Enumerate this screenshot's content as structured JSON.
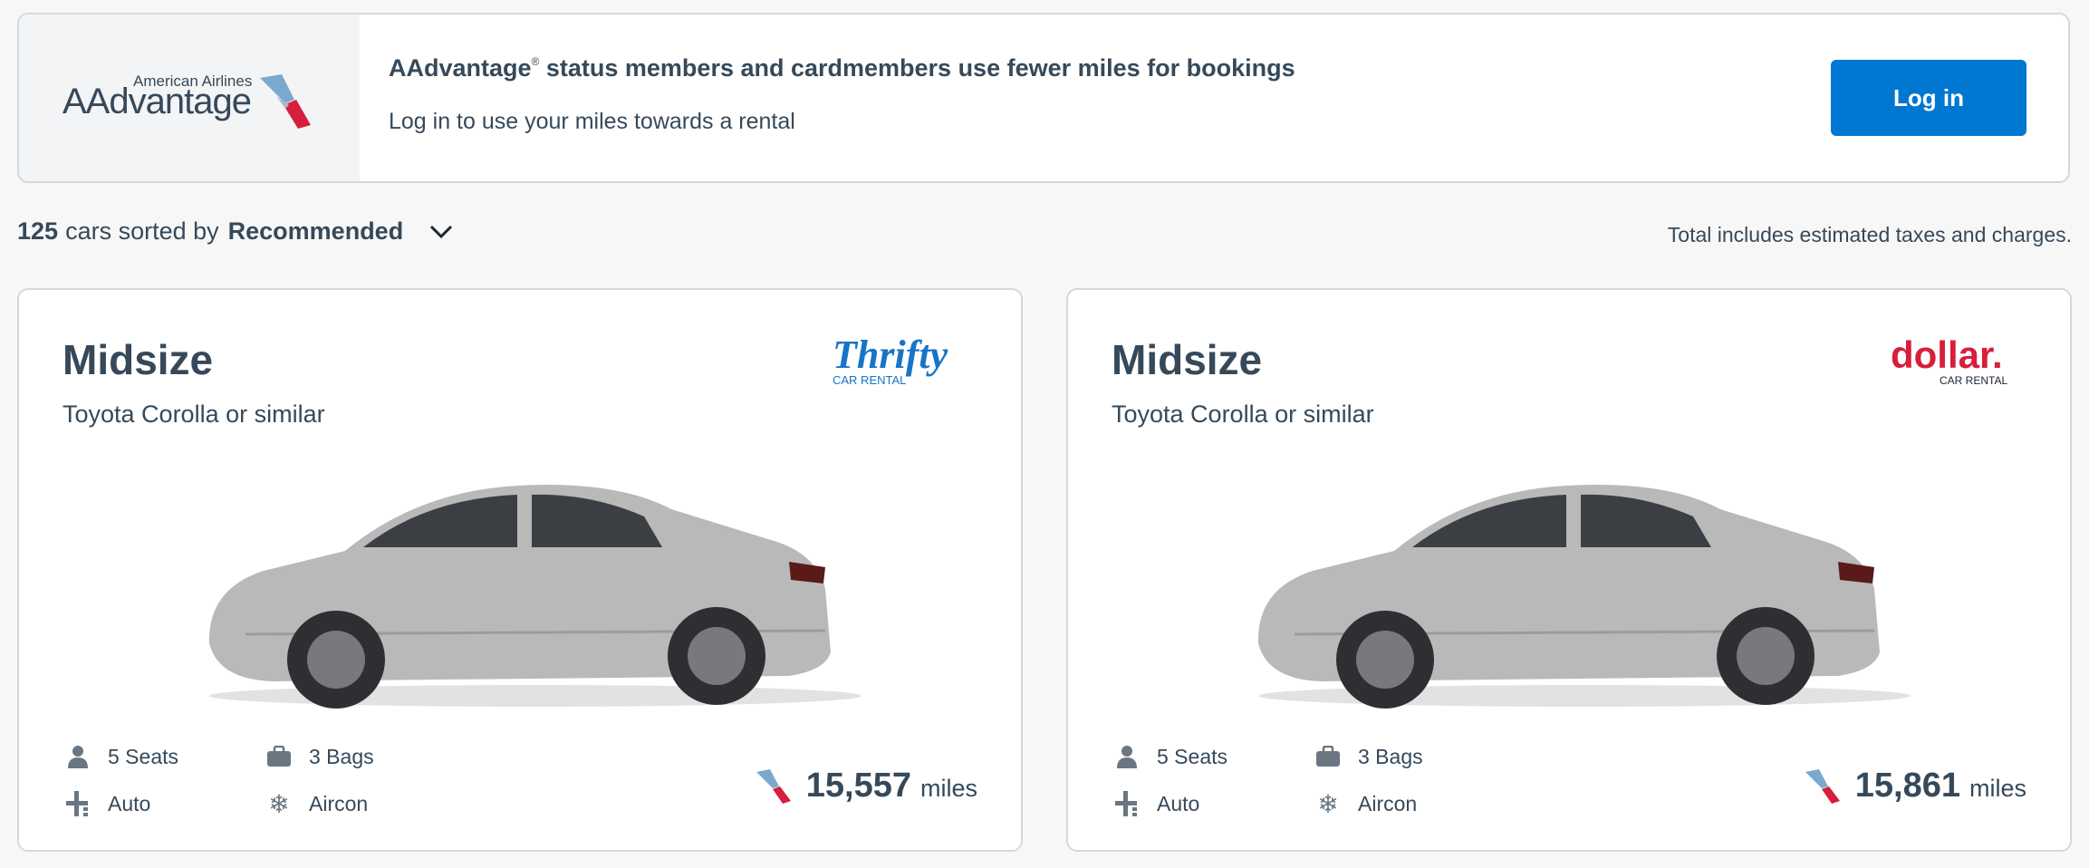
{
  "banner": {
    "logo_small": "American Airlines",
    "logo_big": "AAdvantage",
    "title_brand": "AAdvantage",
    "title_reg": "®",
    "title_rest": " status members and cardmembers use fewer miles for bookings",
    "subtitle": "Log in to use your miles towards a rental",
    "login_label": "Log in"
  },
  "results": {
    "count": "125",
    "sorted_text": "cars sorted by",
    "sort_value": "Recommended",
    "tax_note": "Total includes estimated taxes and charges."
  },
  "cards": [
    {
      "class": "Midsize",
      "model": "Toyota Corolla or similar",
      "vendor": "Thrifty",
      "vendor_sub": "CAR RENTAL",
      "seats": "5 Seats",
      "bags": "3 Bags",
      "transmission": "Auto",
      "aircon": "Aircon",
      "miles": "15,557",
      "miles_unit": "miles"
    },
    {
      "class": "Midsize",
      "model": "Toyota Corolla or similar",
      "vendor": "dollar.",
      "vendor_sub": "CAR RENTAL",
      "seats": "5 Seats",
      "bags": "3 Bags",
      "transmission": "Auto",
      "aircon": "Aircon",
      "miles": "15,861",
      "miles_unit": "miles"
    }
  ],
  "colors": {
    "primary_button": "#0078d2",
    "text": "#36495a",
    "thrifty_blue": "#1874c8",
    "dollar_red": "#d71e3b"
  },
  "icons": {
    "seats": "person-icon",
    "bags": "briefcase-icon",
    "transmission": "gear-shift-icon",
    "aircon": "snowflake-icon",
    "miles": "aa-flight-symbol-icon"
  }
}
